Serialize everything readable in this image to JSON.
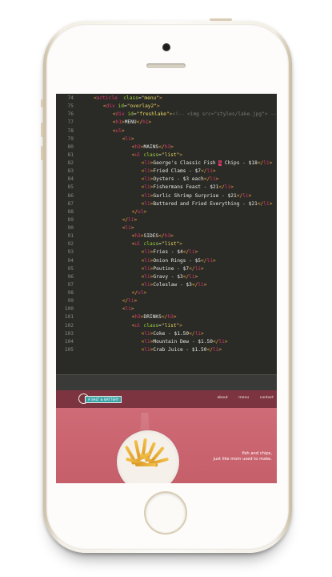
{
  "code_editor": {
    "lines": [
      {
        "num": "74",
        "indent": 0,
        "parts": [
          [
            "t-tag",
            "<"
          ],
          [
            "t-el",
            "article"
          ],
          [
            "",
            "  "
          ],
          [
            "t-attr",
            "class"
          ],
          [
            "",
            "="
          ],
          [
            "t-str",
            "\"menu\""
          ],
          [
            "t-tag",
            ">"
          ]
        ]
      },
      {
        "num": "75",
        "indent": 1,
        "parts": [
          [
            "t-tag",
            "<"
          ],
          [
            "t-el",
            "div"
          ],
          [
            "",
            " "
          ],
          [
            "t-attr",
            "id"
          ],
          [
            "",
            "="
          ],
          [
            "t-str",
            "\"overlay2\""
          ],
          [
            "t-tag",
            ">"
          ]
        ]
      },
      {
        "num": "76",
        "indent": 2,
        "parts": [
          [
            "t-tag",
            "<"
          ],
          [
            "t-el",
            "div"
          ],
          [
            "",
            " "
          ],
          [
            "t-attr",
            "id"
          ],
          [
            "",
            "="
          ],
          [
            "t-str",
            "\"freshlake\""
          ],
          [
            "t-tag",
            ">"
          ],
          [
            "t-com",
            "<!-- <img src=\"styles/lake.jpg\"> -->"
          ],
          [
            "t-tag",
            "</"
          ],
          [
            "t-el",
            "div"
          ],
          [
            "t-tag",
            ">"
          ]
        ]
      },
      {
        "num": "77",
        "indent": 2,
        "parts": [
          [
            "t-tag",
            "<"
          ],
          [
            "t-el",
            "h1"
          ],
          [
            "t-tag",
            ">"
          ],
          [
            "",
            "MENU"
          ],
          [
            "t-tag",
            "</"
          ],
          [
            "t-el",
            "h1"
          ],
          [
            "t-tag",
            ">"
          ]
        ]
      },
      {
        "num": "78",
        "indent": 2,
        "parts": [
          [
            "t-tag",
            "<"
          ],
          [
            "t-el",
            "ul"
          ],
          [
            "t-tag",
            ">"
          ]
        ]
      },
      {
        "num": "79",
        "indent": 3,
        "parts": [
          [
            "t-tag",
            "<"
          ],
          [
            "t-el",
            "li"
          ],
          [
            "t-tag",
            ">"
          ]
        ]
      },
      {
        "num": "80",
        "indent": 4,
        "parts": [
          [
            "t-tag",
            "<"
          ],
          [
            "t-el",
            "h3"
          ],
          [
            "t-tag",
            ">"
          ],
          [
            "",
            "MAINS"
          ],
          [
            "t-tag",
            "</"
          ],
          [
            "t-el",
            "h3"
          ],
          [
            "t-tag",
            ">"
          ]
        ]
      },
      {
        "num": "81",
        "indent": 4,
        "parts": [
          [
            "t-tag",
            "<"
          ],
          [
            "t-el",
            "ul"
          ],
          [
            "",
            " "
          ],
          [
            "t-attr",
            "class"
          ],
          [
            "",
            "="
          ],
          [
            "t-str",
            "\"list\""
          ],
          [
            "t-tag",
            ">"
          ]
        ]
      },
      {
        "num": "82",
        "indent": 5,
        "parts": [
          [
            "t-tag",
            "<"
          ],
          [
            "t-el",
            "li"
          ],
          [
            "t-tag",
            ">"
          ],
          [
            "",
            "George's Classic Fish "
          ],
          [
            "t-cursor",
            "&"
          ],
          [
            "",
            " Chips - $18"
          ],
          [
            "t-tag",
            "</"
          ],
          [
            "t-el",
            "li"
          ],
          [
            "t-tag",
            ">"
          ]
        ]
      },
      {
        "num": "83",
        "indent": 5,
        "parts": [
          [
            "t-tag",
            "<"
          ],
          [
            "t-el",
            "li"
          ],
          [
            "t-tag",
            ">"
          ],
          [
            "",
            "Fried Clams - $7"
          ],
          [
            "t-tag",
            "</"
          ],
          [
            "t-el",
            "li"
          ],
          [
            "t-tag",
            ">"
          ]
        ]
      },
      {
        "num": "84",
        "indent": 5,
        "parts": [
          [
            "t-tag",
            "<"
          ],
          [
            "t-el",
            "li"
          ],
          [
            "t-tag",
            ">"
          ],
          [
            "",
            "Oysters - $3 each"
          ],
          [
            "t-tag",
            "</"
          ],
          [
            "t-el",
            "li"
          ],
          [
            "t-tag",
            ">"
          ]
        ]
      },
      {
        "num": "85",
        "indent": 5,
        "parts": [
          [
            "t-tag",
            "<"
          ],
          [
            "t-el",
            "li"
          ],
          [
            "t-tag",
            ">"
          ],
          [
            "",
            "Fishermans Feast - $21"
          ],
          [
            "t-tag",
            "</"
          ],
          [
            "t-el",
            "li"
          ],
          [
            "t-tag",
            ">"
          ]
        ]
      },
      {
        "num": "86",
        "indent": 5,
        "parts": [
          [
            "t-tag",
            "<"
          ],
          [
            "t-el",
            "li"
          ],
          [
            "t-tag",
            ">"
          ],
          [
            "",
            "Garlic Shrimp Surprise - $21"
          ],
          [
            "t-tag",
            "</"
          ],
          [
            "t-el",
            "li"
          ],
          [
            "t-tag",
            ">"
          ]
        ]
      },
      {
        "num": "87",
        "indent": 5,
        "parts": [
          [
            "t-tag",
            "<"
          ],
          [
            "t-el",
            "li"
          ],
          [
            "t-tag",
            ">"
          ],
          [
            "",
            "Battered and Fried Everything - $21"
          ],
          [
            "t-tag",
            "</"
          ],
          [
            "t-el",
            "li"
          ],
          [
            "t-tag",
            ">"
          ]
        ]
      },
      {
        "num": "88",
        "indent": 4,
        "parts": [
          [
            "t-tag",
            "</"
          ],
          [
            "t-el",
            "ul"
          ],
          [
            "t-tag",
            ">"
          ]
        ]
      },
      {
        "num": "89",
        "indent": 3,
        "parts": [
          [
            "t-tag",
            "</"
          ],
          [
            "t-el",
            "li"
          ],
          [
            "t-tag",
            ">"
          ]
        ]
      },
      {
        "num": "90",
        "indent": 3,
        "parts": [
          [
            "t-tag",
            "<"
          ],
          [
            "t-el",
            "li"
          ],
          [
            "t-tag",
            ">"
          ]
        ]
      },
      {
        "num": "91",
        "indent": 4,
        "parts": [
          [
            "t-tag",
            "<"
          ],
          [
            "t-el",
            "h3"
          ],
          [
            "t-tag",
            ">"
          ],
          [
            "",
            "SIDES"
          ],
          [
            "t-tag",
            "</"
          ],
          [
            "t-el",
            "h3"
          ],
          [
            "t-tag",
            ">"
          ]
        ]
      },
      {
        "num": "92",
        "indent": 4,
        "parts": [
          [
            "t-tag",
            "<"
          ],
          [
            "t-el",
            "ul"
          ],
          [
            "",
            " "
          ],
          [
            "t-attr",
            "class"
          ],
          [
            "",
            "="
          ],
          [
            "t-str",
            "\"list\""
          ],
          [
            "t-tag",
            ">"
          ]
        ]
      },
      {
        "num": "93",
        "indent": 5,
        "parts": [
          [
            "t-tag",
            "<"
          ],
          [
            "t-el",
            "li"
          ],
          [
            "t-tag",
            ">"
          ],
          [
            "",
            "Fries - $4"
          ],
          [
            "t-tag",
            "</"
          ],
          [
            "t-el",
            "li"
          ],
          [
            "t-tag",
            ">"
          ]
        ]
      },
      {
        "num": "94",
        "indent": 5,
        "parts": [
          [
            "t-tag",
            "<"
          ],
          [
            "t-el",
            "li"
          ],
          [
            "t-tag",
            ">"
          ],
          [
            "",
            "Onion Rings - $5"
          ],
          [
            "t-tag",
            "</"
          ],
          [
            "t-el",
            "li"
          ],
          [
            "t-tag",
            ">"
          ]
        ]
      },
      {
        "num": "95",
        "indent": 5,
        "parts": [
          [
            "t-tag",
            "<"
          ],
          [
            "t-el",
            "li"
          ],
          [
            "t-tag",
            ">"
          ],
          [
            "",
            "Poutine - $7"
          ],
          [
            "t-tag",
            "</"
          ],
          [
            "t-el",
            "li"
          ],
          [
            "t-tag",
            ">"
          ]
        ]
      },
      {
        "num": "96",
        "indent": 5,
        "parts": [
          [
            "t-tag",
            "<"
          ],
          [
            "t-el",
            "li"
          ],
          [
            "t-tag",
            ">"
          ],
          [
            "",
            "Gravy - $3"
          ],
          [
            "t-tag",
            "</"
          ],
          [
            "t-el",
            "li"
          ],
          [
            "t-tag",
            ">"
          ]
        ]
      },
      {
        "num": "97",
        "indent": 5,
        "parts": [
          [
            "t-tag",
            "<"
          ],
          [
            "t-el",
            "li"
          ],
          [
            "t-tag",
            ">"
          ],
          [
            "",
            "Coleslaw - $3"
          ],
          [
            "t-tag",
            "</"
          ],
          [
            "t-el",
            "li"
          ],
          [
            "t-tag",
            ">"
          ]
        ]
      },
      {
        "num": "98",
        "indent": 4,
        "parts": [
          [
            "t-tag",
            "</"
          ],
          [
            "t-el",
            "ul"
          ],
          [
            "t-tag",
            ">"
          ]
        ]
      },
      {
        "num": "99",
        "indent": 3,
        "parts": [
          [
            "t-tag",
            "</"
          ],
          [
            "t-el",
            "li"
          ],
          [
            "t-tag",
            ">"
          ]
        ]
      },
      {
        "num": "100",
        "indent": 3,
        "parts": [
          [
            "t-tag",
            "<"
          ],
          [
            "t-el",
            "li"
          ],
          [
            "t-tag",
            ">"
          ]
        ]
      },
      {
        "num": "101",
        "indent": 4,
        "parts": [
          [
            "t-tag",
            "<"
          ],
          [
            "t-el",
            "h3"
          ],
          [
            "t-tag",
            ">"
          ],
          [
            "",
            "DRINKS"
          ],
          [
            "t-tag",
            "</"
          ],
          [
            "t-el",
            "h3"
          ],
          [
            "t-tag",
            ">"
          ]
        ]
      },
      {
        "num": "102",
        "indent": 4,
        "parts": [
          [
            "t-tag",
            "<"
          ],
          [
            "t-el",
            "ul"
          ],
          [
            "",
            " "
          ],
          [
            "t-attr",
            "class"
          ],
          [
            "",
            "="
          ],
          [
            "t-str",
            "\"list\""
          ],
          [
            "t-tag",
            ">"
          ]
        ]
      },
      {
        "num": "103",
        "indent": 5,
        "parts": [
          [
            "t-tag",
            "<"
          ],
          [
            "t-el",
            "li"
          ],
          [
            "t-tag",
            ">"
          ],
          [
            "",
            "Coke - $1.50"
          ],
          [
            "t-tag",
            "</"
          ],
          [
            "t-el",
            "li"
          ],
          [
            "t-tag",
            ">"
          ]
        ]
      },
      {
        "num": "104",
        "indent": 5,
        "parts": [
          [
            "t-tag",
            "<"
          ],
          [
            "t-el",
            "li"
          ],
          [
            "t-tag",
            ">"
          ],
          [
            "",
            "Mountain Dew - $1.50"
          ],
          [
            "t-tag",
            "</"
          ],
          [
            "t-el",
            "li"
          ],
          [
            "t-tag",
            ">"
          ]
        ]
      },
      {
        "num": "105",
        "indent": 5,
        "parts": [
          [
            "t-tag",
            "<"
          ],
          [
            "t-el",
            "li"
          ],
          [
            "t-tag",
            ">"
          ],
          [
            "",
            "Crab Juice - $1.50"
          ],
          [
            "t-tag",
            "</"
          ],
          [
            "t-el",
            "li"
          ],
          [
            "t-tag",
            ">"
          ]
        ]
      }
    ]
  },
  "website": {
    "logo_text": "A SALT & BATTERY",
    "nav": {
      "about": "about",
      "menu": "menu",
      "contact": "contact"
    },
    "tagline_line1": "fish and chips,",
    "tagline_line2": "just like mom used to make."
  },
  "colors": {
    "editor_bg": "#2a2a27",
    "nav_bg": "#7c3540",
    "hero_bg": "#c8606b",
    "logo_accent": "#3aa3a8"
  }
}
